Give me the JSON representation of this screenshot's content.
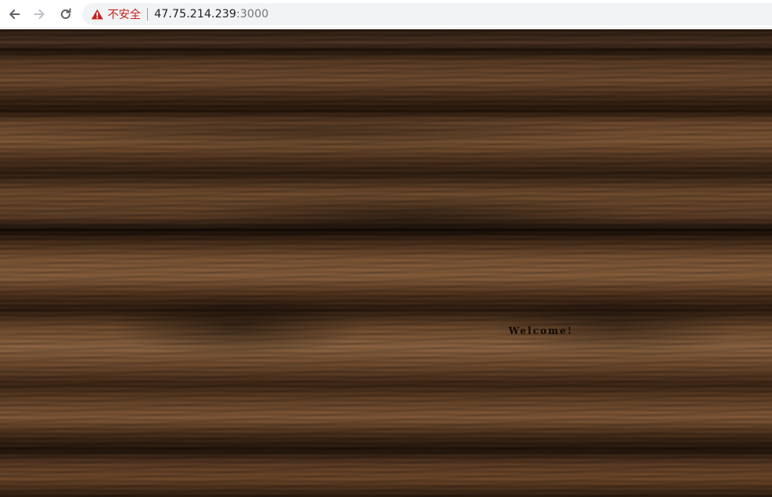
{
  "browser": {
    "security_label": "不安全",
    "url_host": "47.75.214.239",
    "url_port": ":3000",
    "back_icon": "back-arrow-icon",
    "forward_icon": "forward-arrow-icon",
    "reload_icon": "reload-icon",
    "warning_icon": "warning-triangle-icon",
    "warning_color": "#c5221f"
  },
  "page": {
    "welcome_text": "Welcome!"
  }
}
